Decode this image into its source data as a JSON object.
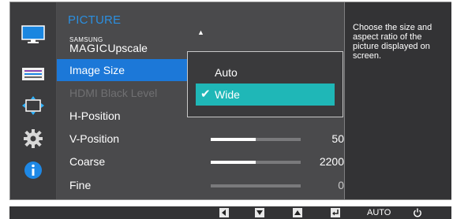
{
  "menu": {
    "title": "PICTURE",
    "items": [
      {
        "brand_top": "SAMSUNG",
        "brand_main": "MAGIC",
        "label": "Upscale"
      },
      {
        "label": "Image Size"
      },
      {
        "label": "HDMI Black Level"
      },
      {
        "label": "H-Position"
      },
      {
        "label": "V-Position",
        "value": "50",
        "level": 0.5
      },
      {
        "label": "Coarse",
        "value": "2200",
        "level": 0.5
      },
      {
        "label": "Fine",
        "value": "0",
        "level": 0.0
      }
    ]
  },
  "submenu": {
    "options": [
      {
        "label": "Auto"
      },
      {
        "label": "Wide"
      }
    ]
  },
  "description": "Choose the size and aspect ratio of the picture displayed on screen.",
  "bottom_bar": {
    "auto_label": "AUTO"
  },
  "colors": {
    "accent_blue": "#1c78d8",
    "title_blue": "#2b8fe0",
    "selected_teal": "#1fb7b7"
  },
  "icons": [
    "monitor-icon",
    "onscreen-display-icon",
    "position-arrows-icon",
    "gear-icon",
    "info-icon",
    "left-arrow-icon",
    "down-arrow-icon",
    "up-arrow-icon",
    "enter-icon",
    "power-icon"
  ]
}
